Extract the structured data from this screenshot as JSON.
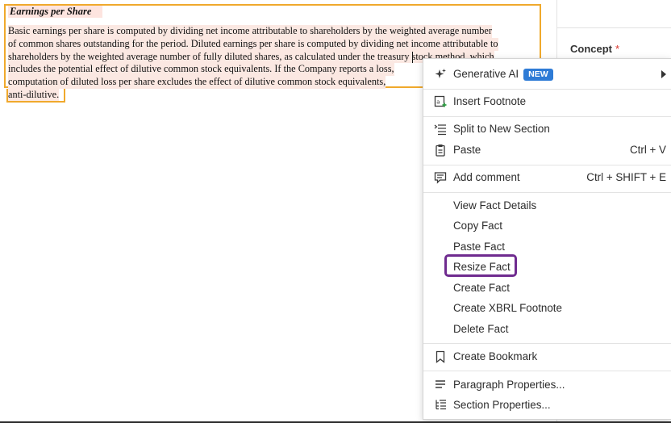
{
  "document": {
    "heading": "Earnings per Share",
    "paragraph_lines": [
      "Basic earnings per share is computed by dividing net income attributable to shareholders by the weighted average number",
      "of common shares outstanding for the period. Diluted earnings per share is computed by dividing net income attributable to",
      "shareholders by the weighted average number of fully diluted shares, as calculated under the treasury stock method, which",
      "includes the potential effect of dilutive common stock equivalents. If the Company reports a loss,",
      "computation of diluted loss per share excludes the effect of dilutive common stock equivalents,",
      "anti-dilutive."
    ],
    "accent_color": "#f0a92c",
    "highlight_color": "#fbe8e2"
  },
  "right_panel": {
    "concept_label": "Concept",
    "required_mark": "*"
  },
  "context_menu": {
    "generative_ai": {
      "label": "Generative AI",
      "badge": "NEW",
      "icon": "sparkle-icon"
    },
    "insert_footnote": {
      "label": "Insert Footnote",
      "icon": "footnote-add-icon"
    },
    "split_section": {
      "label": "Split to New Section",
      "icon": "split-list-icon"
    },
    "paste": {
      "label": "Paste",
      "shortcut": "Ctrl + V",
      "icon": "clipboard-icon"
    },
    "add_comment": {
      "label": "Add comment",
      "shortcut": "Ctrl + SHIFT + E",
      "icon": "comment-add-icon"
    },
    "view_fact_details": {
      "label": "View Fact Details"
    },
    "copy_fact": {
      "label": "Copy Fact"
    },
    "paste_fact": {
      "label": "Paste Fact"
    },
    "resize_fact": {
      "label": "Resize Fact",
      "highlight_color": "#6f2b8f"
    },
    "create_fact": {
      "label": "Create Fact"
    },
    "create_xbrl_footnote": {
      "label": "Create XBRL Footnote"
    },
    "delete_fact": {
      "label": "Delete Fact"
    },
    "create_bookmark": {
      "label": "Create Bookmark",
      "icon": "bookmark-icon"
    },
    "paragraph_properties": {
      "label": "Paragraph Properties...",
      "icon": "paragraph-icon"
    },
    "section_properties": {
      "label": "Section Properties...",
      "icon": "section-tree-icon"
    }
  }
}
